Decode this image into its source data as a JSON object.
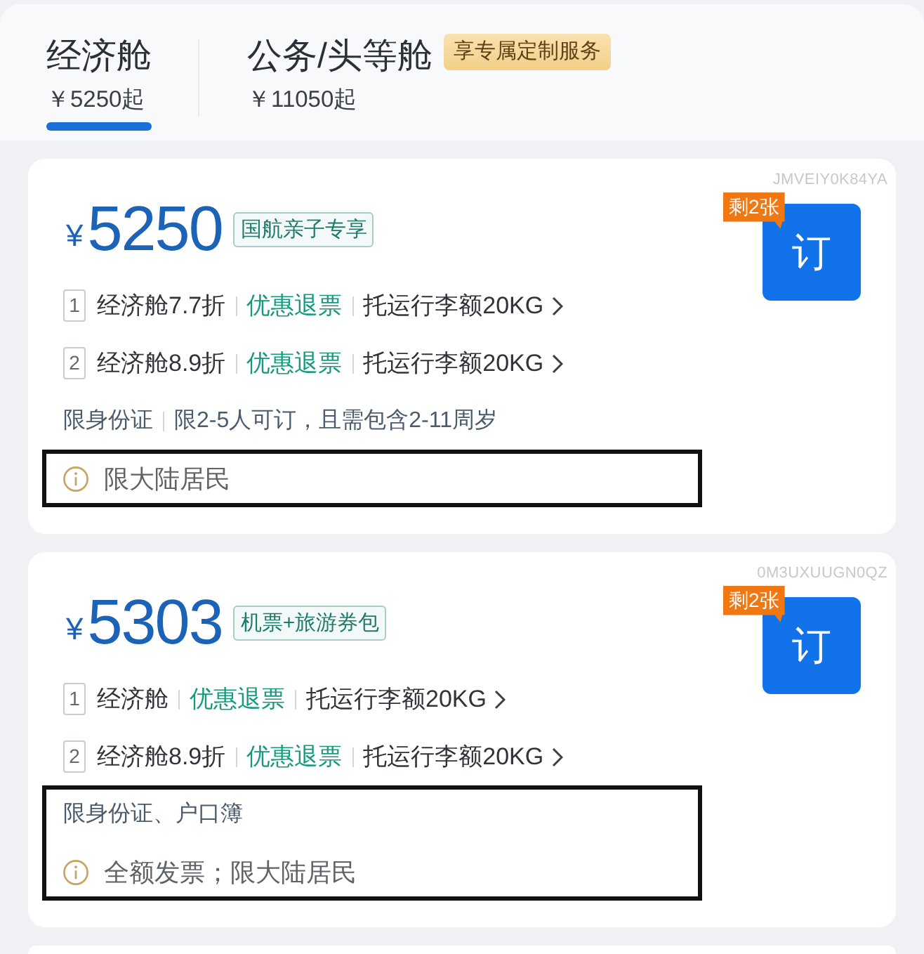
{
  "tabs": [
    {
      "label": "经济舱",
      "price": "￥5250起",
      "selected": true
    },
    {
      "label": "公务/头等舱",
      "badge": "享专属定制服务",
      "price": "￥11050起",
      "selected": false
    }
  ],
  "offers": [
    {
      "code": "JMVEIY0K84YA",
      "currency": "¥",
      "price": "5250",
      "tag": "国航亲子专享",
      "stock_badge": "剩2张",
      "book_label": "订",
      "fares": [
        {
          "number": "1",
          "cabin": "经济舱7.7折",
          "refund": "优惠退票",
          "baggage": "托运行李额20KG"
        },
        {
          "number": "2",
          "cabin": "经济舱8.9折",
          "refund": "优惠退票",
          "baggage": "托运行李额20KG"
        }
      ],
      "restriction": {
        "parts": [
          "限身份证",
          "限2-5人可订，且需包含2-11周岁"
        ],
        "highlighted": false
      },
      "note": {
        "text": "限大陆居民",
        "highlighted": true
      }
    },
    {
      "code": "0M3UXUUGN0QZ",
      "currency": "¥",
      "price": "5303",
      "tag": "机票+旅游券包",
      "stock_badge": "剩2张",
      "book_label": "订",
      "fares": [
        {
          "number": "1",
          "cabin": "经济舱",
          "refund": "优惠退票",
          "baggage": "托运行李额20KG"
        },
        {
          "number": "2",
          "cabin": "经济舱8.9折",
          "refund": "优惠退票",
          "baggage": "托运行李额20KG"
        }
      ],
      "restriction": {
        "parts": [
          "限身份证、户口簿"
        ],
        "highlighted": true
      },
      "note": {
        "text": "全额发票；限大陆居民",
        "highlighted": true
      }
    }
  ]
}
